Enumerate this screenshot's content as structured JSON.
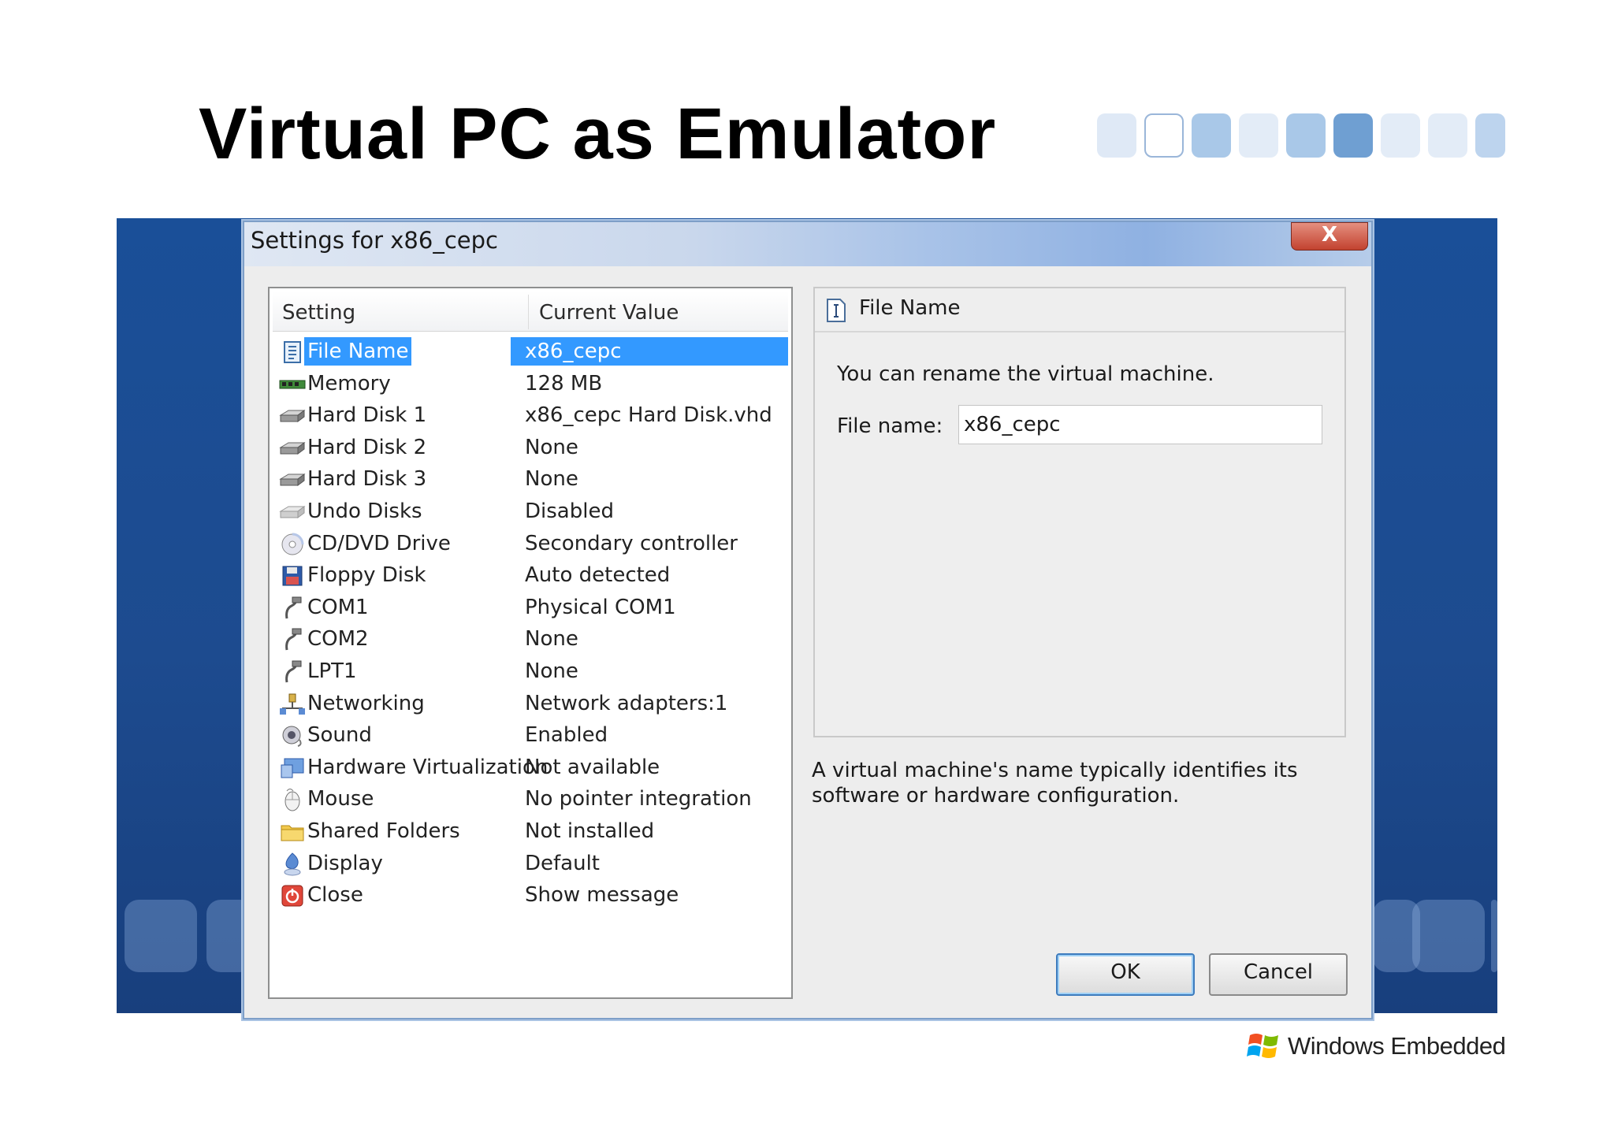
{
  "slide": {
    "title": "Virtual PC as Emulator",
    "logo_text": "Windows Embedded"
  },
  "dialog": {
    "title": "Settings for x86_cepc",
    "close_label": "X",
    "columns": {
      "setting": "Setting",
      "value": "Current Value"
    },
    "rows": [
      {
        "name": "File Name",
        "value": "x86_cepc",
        "icon": "file-icon",
        "selected": true
      },
      {
        "name": "Memory",
        "value": "128 MB",
        "icon": "memory-icon"
      },
      {
        "name": "Hard Disk 1",
        "value": "x86_cepc Hard Disk.vhd",
        "icon": "hard-disk-icon"
      },
      {
        "name": "Hard Disk 2",
        "value": "None",
        "icon": "hard-disk-icon"
      },
      {
        "name": "Hard Disk 3",
        "value": "None",
        "icon": "hard-disk-icon"
      },
      {
        "name": "Undo Disks",
        "value": "Disabled",
        "icon": "undo-disk-icon"
      },
      {
        "name": "CD/DVD Drive",
        "value": "Secondary controller",
        "icon": "cd-icon"
      },
      {
        "name": "Floppy Disk",
        "value": "Auto detected",
        "icon": "floppy-icon"
      },
      {
        "name": "COM1",
        "value": "Physical COM1",
        "icon": "port-icon"
      },
      {
        "name": "COM2",
        "value": "None",
        "icon": "port-icon"
      },
      {
        "name": "LPT1",
        "value": "None",
        "icon": "port-icon"
      },
      {
        "name": "Networking",
        "value": "Network adapters:1",
        "icon": "network-icon"
      },
      {
        "name": "Sound",
        "value": "Enabled",
        "icon": "sound-icon"
      },
      {
        "name": "Hardware Virtualization",
        "value": "Not available",
        "icon": "hardware-icon"
      },
      {
        "name": "Mouse",
        "value": "No pointer integration",
        "icon": "mouse-icon"
      },
      {
        "name": "Shared Folders",
        "value": "Not installed",
        "icon": "folder-icon"
      },
      {
        "name": "Display",
        "value": "Default",
        "icon": "display-icon"
      },
      {
        "name": "Close",
        "value": "Show message",
        "icon": "power-icon"
      }
    ],
    "detail": {
      "header": "File Name",
      "description": "You can rename the virtual machine.",
      "field_label": "File name:",
      "field_value": "x86_cepc"
    },
    "help_text": "A virtual machine's name typically identifies its software or hardware configuration.",
    "ok_label": "OK",
    "cancel_label": "Cancel"
  },
  "colors": {
    "selection": "#3399ff",
    "background_band": "#1a4f98"
  }
}
